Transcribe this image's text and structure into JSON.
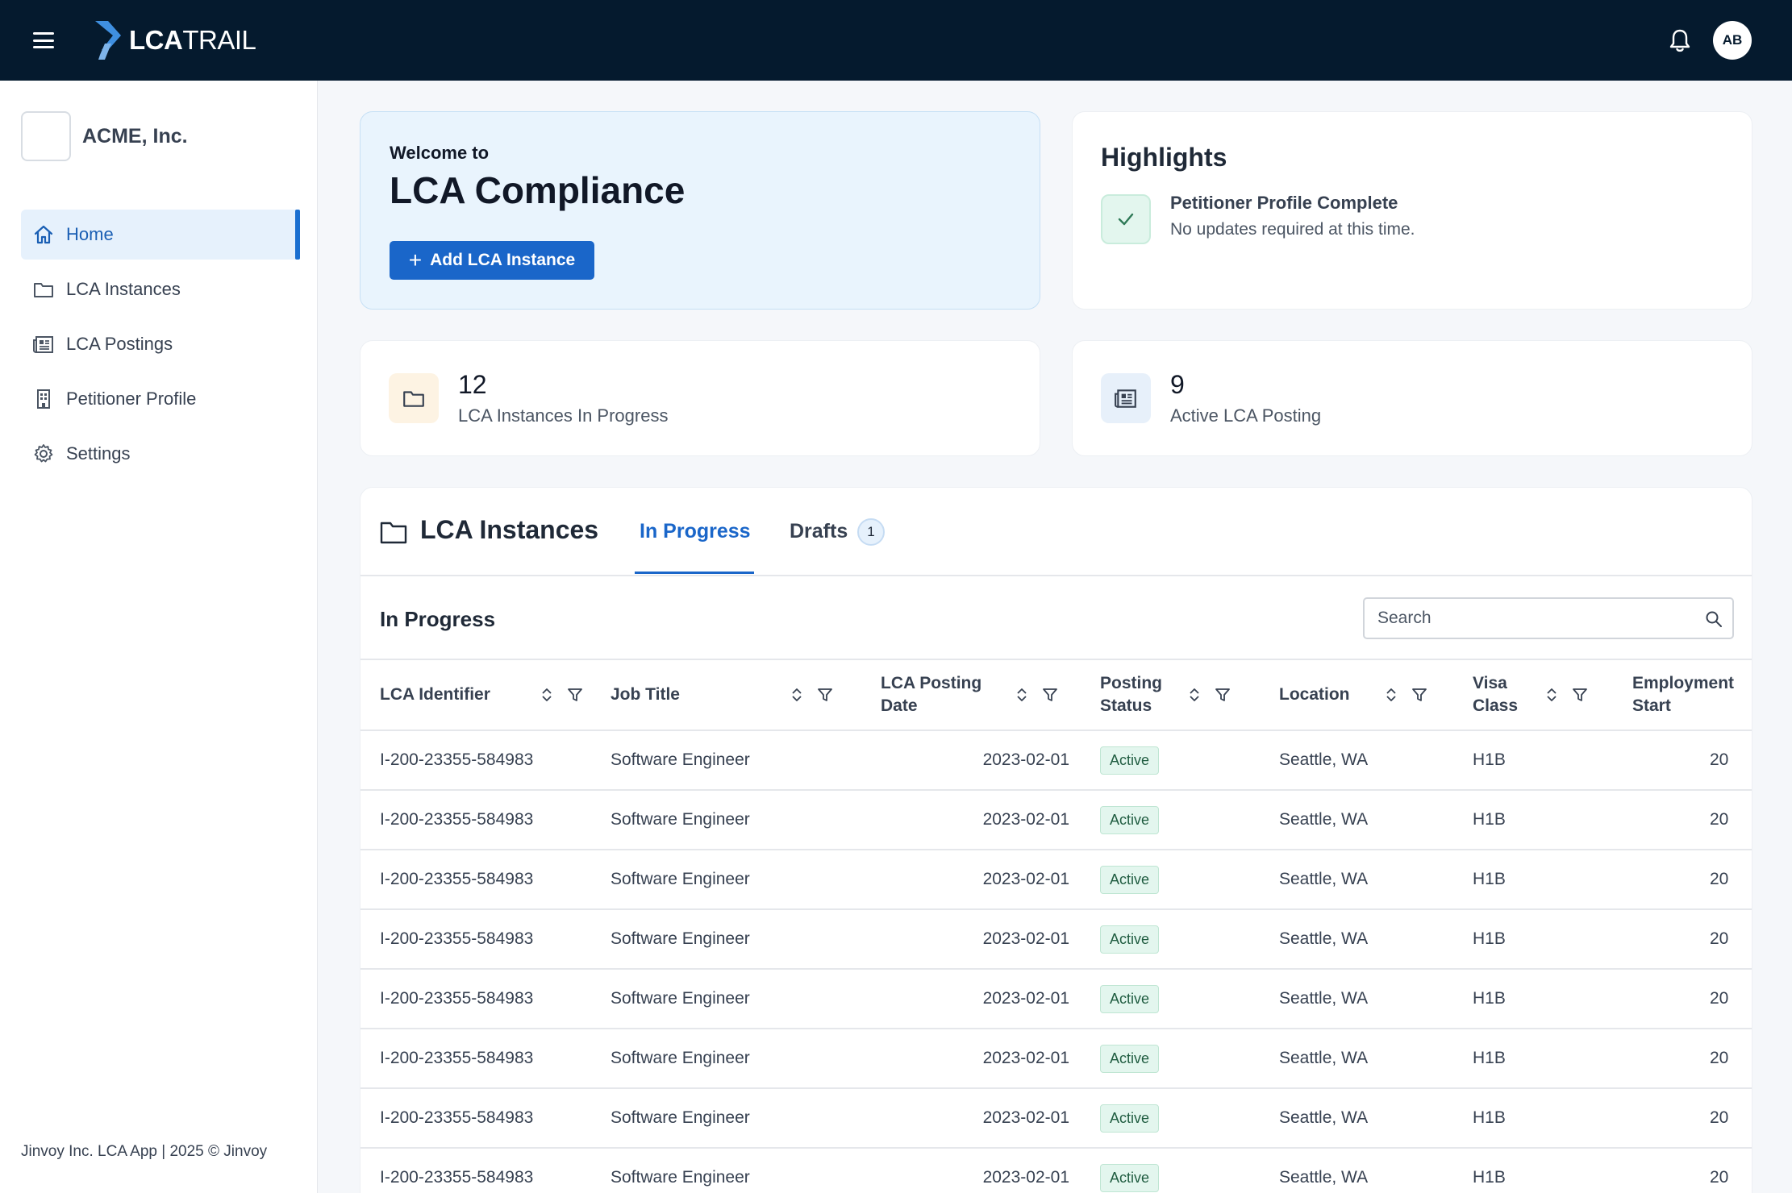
{
  "brand": {
    "logo_bold": "LCA",
    "logo_light": "TRAIL"
  },
  "user": {
    "initials": "AB"
  },
  "colors": {
    "topbar": "#051a2e",
    "accent": "#1a66c9",
    "welcome_bg": "#e9f4fd",
    "success_bg": "#e3f6ee"
  },
  "sidebar": {
    "org_name": "ACME, Inc.",
    "items": [
      {
        "label": "Home",
        "icon": "home-icon",
        "active": true
      },
      {
        "label": "LCA Instances",
        "icon": "folder-icon"
      },
      {
        "label": "LCA Postings",
        "icon": "newspaper-icon"
      },
      {
        "label": "Petitioner Profile",
        "icon": "building-icon"
      },
      {
        "label": "Settings",
        "icon": "gear-icon"
      }
    ],
    "footer": "Jinvoy Inc. LCA App | 2025 © Jinvoy"
  },
  "welcome": {
    "pre": "Welcome to",
    "title": "LCA Compliance",
    "button": "Add LCA Instance"
  },
  "highlights": {
    "title": "Highlights",
    "item_title": "Petitioner Profile Complete",
    "item_sub": "No updates required at this time."
  },
  "stats": [
    {
      "value": "12",
      "label": "LCA Instances In Progress",
      "icon": "folder-icon"
    },
    {
      "value": "9",
      "label": "Active LCA Posting",
      "icon": "newspaper-icon"
    }
  ],
  "instances": {
    "title": "LCA Instances",
    "tabs": {
      "in_progress": "In Progress",
      "drafts": "Drafts",
      "drafts_count": "1"
    },
    "section_title": "In Progress",
    "search_placeholder": "Search",
    "columns": [
      "LCA Identifier",
      "Job Title",
      "LCA Posting Date",
      "Posting Status",
      "Location",
      "Visa Class",
      "Employment Start"
    ],
    "rows": [
      [
        "I-200-23355-584983",
        "Software Engineer",
        "2023-02-01",
        "Active",
        "Seattle, WA",
        "H1B",
        "20"
      ],
      [
        "I-200-23355-584983",
        "Software Engineer",
        "2023-02-01",
        "Active",
        "Seattle, WA",
        "H1B",
        "20"
      ],
      [
        "I-200-23355-584983",
        "Software Engineer",
        "2023-02-01",
        "Active",
        "Seattle, WA",
        "H1B",
        "20"
      ],
      [
        "I-200-23355-584983",
        "Software Engineer",
        "2023-02-01",
        "Active",
        "Seattle, WA",
        "H1B",
        "20"
      ],
      [
        "I-200-23355-584983",
        "Software Engineer",
        "2023-02-01",
        "Active",
        "Seattle, WA",
        "H1B",
        "20"
      ],
      [
        "I-200-23355-584983",
        "Software Engineer",
        "2023-02-01",
        "Active",
        "Seattle, WA",
        "H1B",
        "20"
      ],
      [
        "I-200-23355-584983",
        "Software Engineer",
        "2023-02-01",
        "Active",
        "Seattle, WA",
        "H1B",
        "20"
      ],
      [
        "I-200-23355-584983",
        "Software Engineer",
        "2023-02-01",
        "Active",
        "Seattle, WA",
        "H1B",
        "20"
      ]
    ]
  }
}
